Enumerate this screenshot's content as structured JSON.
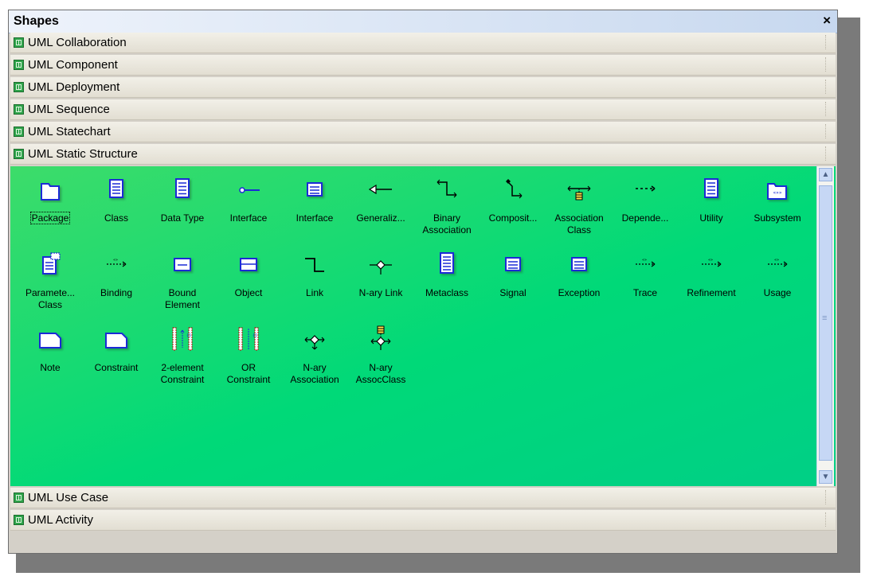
{
  "panel": {
    "title": "Shapes",
    "close_label": "×"
  },
  "stencils_top": [
    "UML Collaboration",
    "UML Component",
    "UML Deployment",
    "UML Sequence",
    "UML Statechart",
    "UML Static Structure"
  ],
  "stencils_bottom": [
    "UML Use Case",
    "UML Activity"
  ],
  "shapes": [
    {
      "label": "Package",
      "icon": "package-icon",
      "selected": true
    },
    {
      "label": "Class",
      "icon": "class-icon"
    },
    {
      "label": "Data Type",
      "icon": "data-type-icon"
    },
    {
      "label": "Interface",
      "icon": "interface-lollipop-icon"
    },
    {
      "label": "Interface",
      "icon": "interface-box-icon"
    },
    {
      "label": "Generaliz...",
      "icon": "generalization-icon"
    },
    {
      "label": "Binary\nAssociation",
      "icon": "binary-association-icon"
    },
    {
      "label": "Composit...",
      "icon": "composition-icon"
    },
    {
      "label": "Association\nClass",
      "icon": "association-class-icon"
    },
    {
      "label": "Depende...",
      "icon": "dependency-icon"
    },
    {
      "label": "Utility",
      "icon": "utility-icon"
    },
    {
      "label": "Subsystem",
      "icon": "subsystem-icon"
    },
    {
      "label": "Paramete...\nClass",
      "icon": "parameterized-class-icon"
    },
    {
      "label": "Binding",
      "icon": "binding-icon"
    },
    {
      "label": "Bound\nElement",
      "icon": "bound-element-icon"
    },
    {
      "label": "Object",
      "icon": "object-icon"
    },
    {
      "label": "Link",
      "icon": "link-icon"
    },
    {
      "label": "N-ary Link",
      "icon": "nary-link-icon"
    },
    {
      "label": "Metaclass",
      "icon": "metaclass-icon"
    },
    {
      "label": "Signal",
      "icon": "signal-icon"
    },
    {
      "label": "Exception",
      "icon": "exception-icon"
    },
    {
      "label": "Trace",
      "icon": "trace-icon"
    },
    {
      "label": "Refinement",
      "icon": "refinement-icon"
    },
    {
      "label": "Usage",
      "icon": "usage-icon"
    },
    {
      "label": "Note",
      "icon": "note-icon"
    },
    {
      "label": "Constraint",
      "icon": "constraint-icon"
    },
    {
      "label": "2-element\nConstraint",
      "icon": "two-element-constraint-icon"
    },
    {
      "label": "OR\nConstraint",
      "icon": "or-constraint-icon"
    },
    {
      "label": "N-ary\nAssociation",
      "icon": "nary-association-icon"
    },
    {
      "label": "N-ary\nAssocClass",
      "icon": "nary-assoc-class-icon"
    }
  ],
  "colors": {
    "palette_start": "#3ddc6a",
    "palette_end": "#00cf86",
    "icon_blue": "#1a2bd6"
  }
}
